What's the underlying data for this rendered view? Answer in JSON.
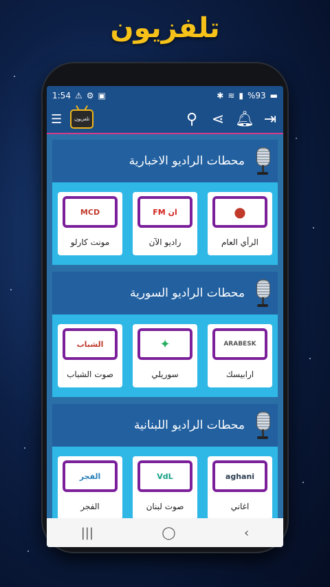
{
  "promo": {
    "title": "تلفزيون"
  },
  "status_bar": {
    "time": "1:54",
    "battery": "%93"
  },
  "app_bar": {
    "logo_text": "تلفزيون"
  },
  "sections": [
    {
      "title": "محطات الراديو الاخبارية",
      "cards": [
        {
          "name": "الرأي العام",
          "logo": "●"
        },
        {
          "name": "راديو الآن",
          "logo": "FM ان"
        },
        {
          "name": "مونت كارلو",
          "logo": "MCD"
        }
      ]
    },
    {
      "title": "محطات الراديو السورية",
      "cards": [
        {
          "name": "ارابيسك",
          "logo": "ARABESK"
        },
        {
          "name": "سوريلي",
          "logo": "✦"
        },
        {
          "name": "صوت الشباب",
          "logo": "الشباب"
        }
      ]
    },
    {
      "title": "محطات الراديو اللبنانية",
      "cards": [
        {
          "name": "اغاني",
          "logo": "aghani"
        },
        {
          "name": "صوت لبنان",
          "logo": "VdL"
        },
        {
          "name": "الفجر",
          "logo": "الفجر"
        }
      ]
    }
  ],
  "icons": {
    "menu": "menu-icon",
    "search": "search-icon",
    "share": "share-icon",
    "bell": "bell-icon",
    "exit": "exit-icon"
  }
}
